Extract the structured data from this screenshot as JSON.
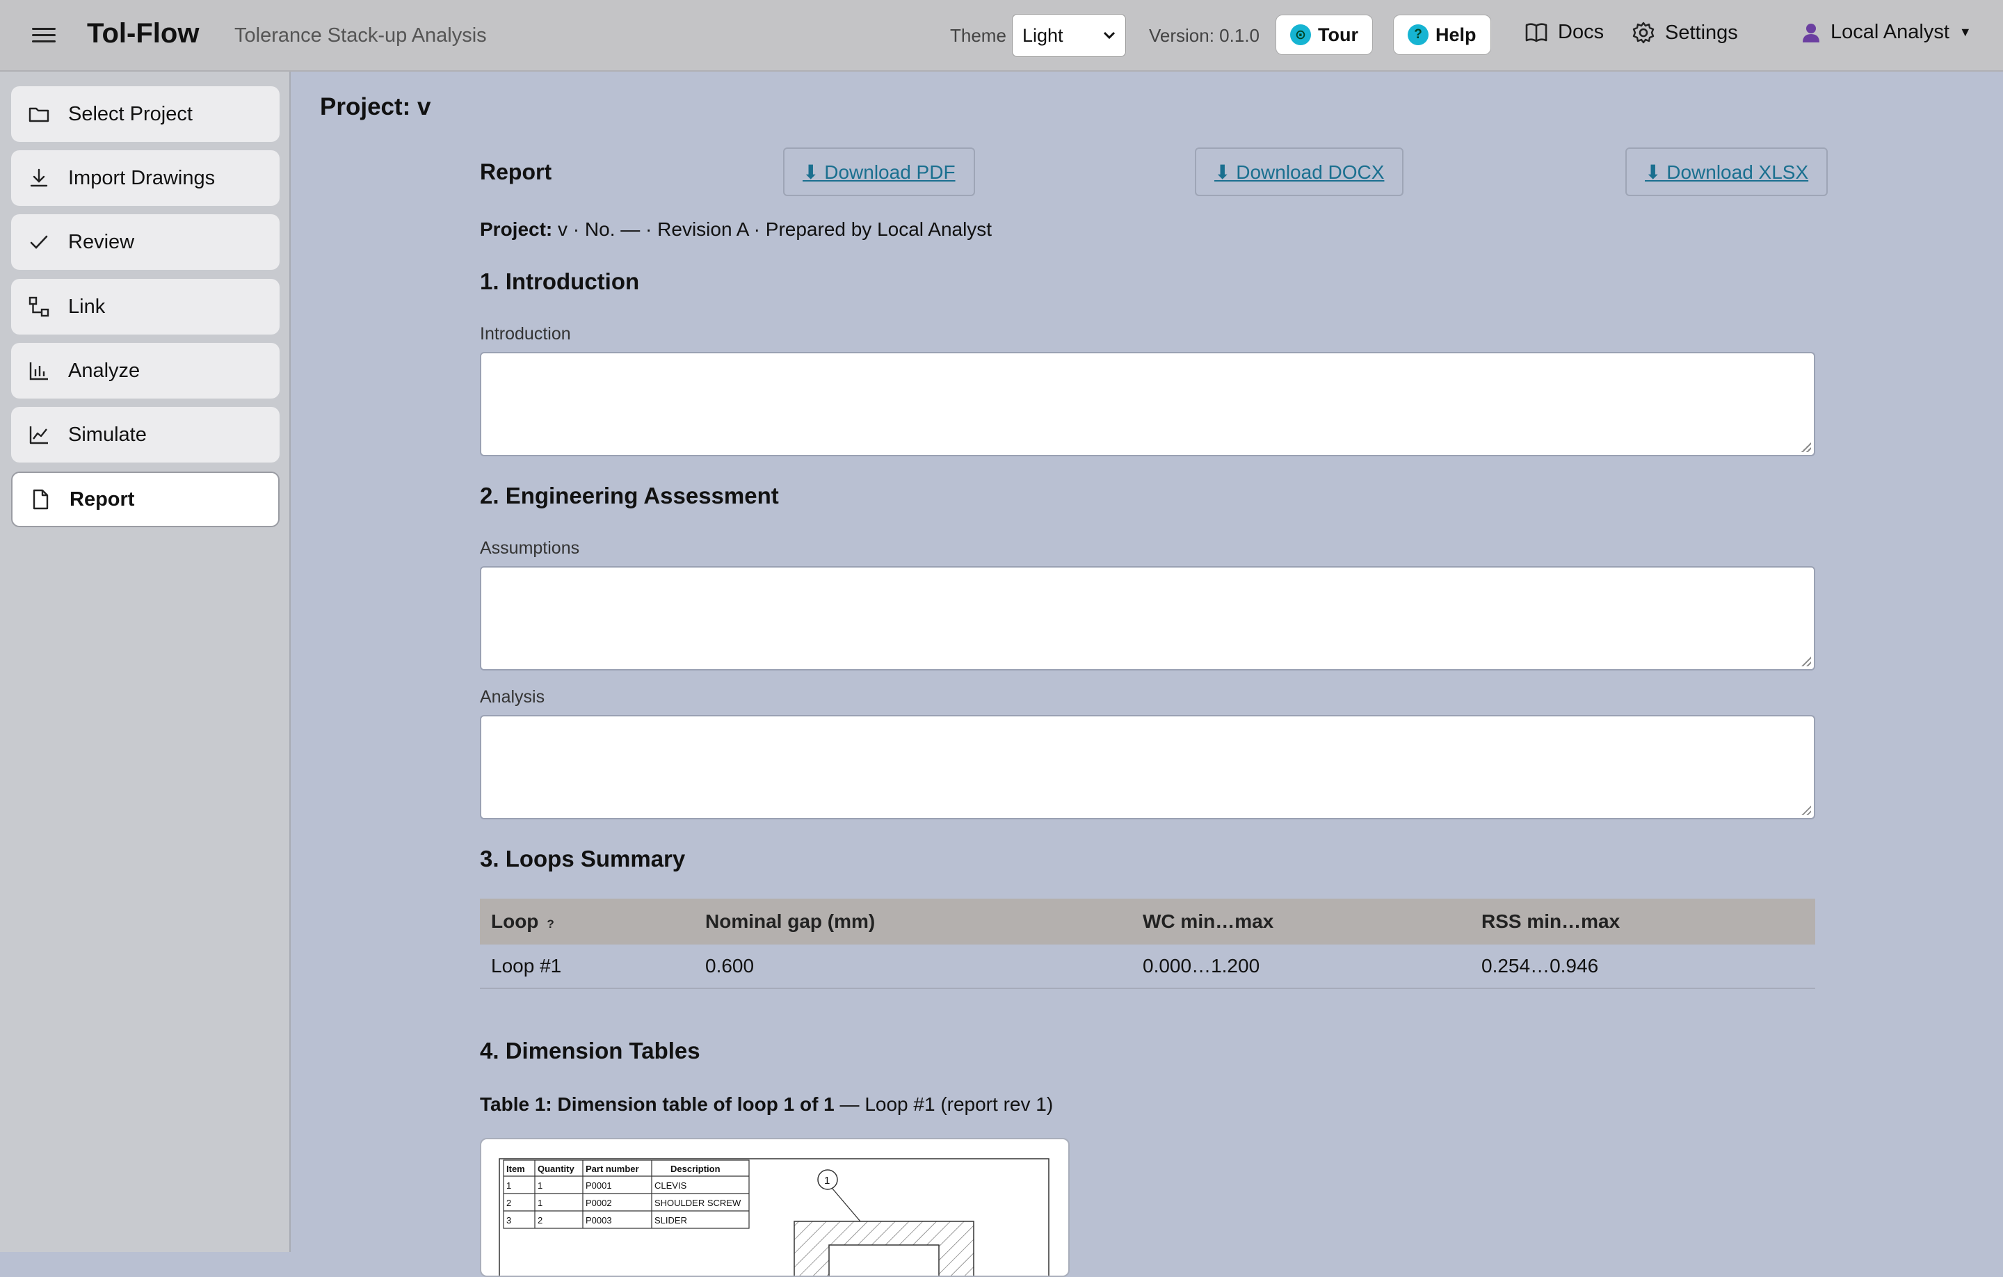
{
  "topbar": {
    "brand": "Tol-Flow",
    "subtitle": "Tolerance Stack-up Analysis",
    "theme_label": "Theme",
    "theme_value": "Light",
    "version": "Version: 0.1.0",
    "tour_label": "Tour",
    "help_label": "Help",
    "docs_label": "Docs",
    "settings_label": "Settings",
    "user_label": "Local Analyst"
  },
  "sidebar": {
    "items": [
      {
        "label": "Select Project",
        "icon": "folder-icon"
      },
      {
        "label": "Import Drawings",
        "icon": "download-icon"
      },
      {
        "label": "Review",
        "icon": "check-icon"
      },
      {
        "label": "Link",
        "icon": "link-icon"
      },
      {
        "label": "Analyze",
        "icon": "bar-chart-icon"
      },
      {
        "label": "Simulate",
        "icon": "line-chart-icon"
      },
      {
        "label": "Report",
        "icon": "document-icon",
        "active": true
      }
    ]
  },
  "main": {
    "project_title": "Project: v",
    "report_heading": "Report",
    "download_pdf": "⬇ Download PDF",
    "download_docx": "⬇ Download DOCX",
    "download_xlsx": "⬇ Download XLSX",
    "meta_label": "Project:",
    "meta_text": " v · No. — · Revision A · Prepared by Local Analyst",
    "sections": {
      "intro": "1. Introduction",
      "intro_field": "Introduction",
      "assessment": "2. Engineering Assessment",
      "assumptions_field": "Assumptions",
      "analysis_field": "Analysis",
      "loops": "3. Loops Summary",
      "dims": "4. Dimension Tables"
    },
    "loops_table": {
      "headers": [
        "Loop",
        "Nominal gap (mm)",
        "WC min…max",
        "RSS min…max"
      ],
      "tip": "?",
      "rows": [
        [
          "Loop #1",
          "0.600",
          "0.000…1.200",
          "0.254…0.946"
        ]
      ]
    },
    "caption_bold": "Table 1: Dimension table of loop 1 of 1",
    "caption_rest": " — Loop #1 (report rev 1)",
    "bom": {
      "headers": [
        "Item",
        "Quantity",
        "Part number",
        "Description"
      ],
      "rows": [
        [
          "1",
          "1",
          "P0001",
          "CLEVIS"
        ],
        [
          "2",
          "1",
          "P0002",
          "SHOULDER SCREW"
        ],
        [
          "3",
          "2",
          "P0003",
          "SLIDER"
        ]
      ],
      "balloon": "1"
    }
  },
  "colors": {
    "accent_link": "#1a6f8f",
    "page_bg": "#b9c0d2",
    "tour_icon": "#16b4d2"
  }
}
